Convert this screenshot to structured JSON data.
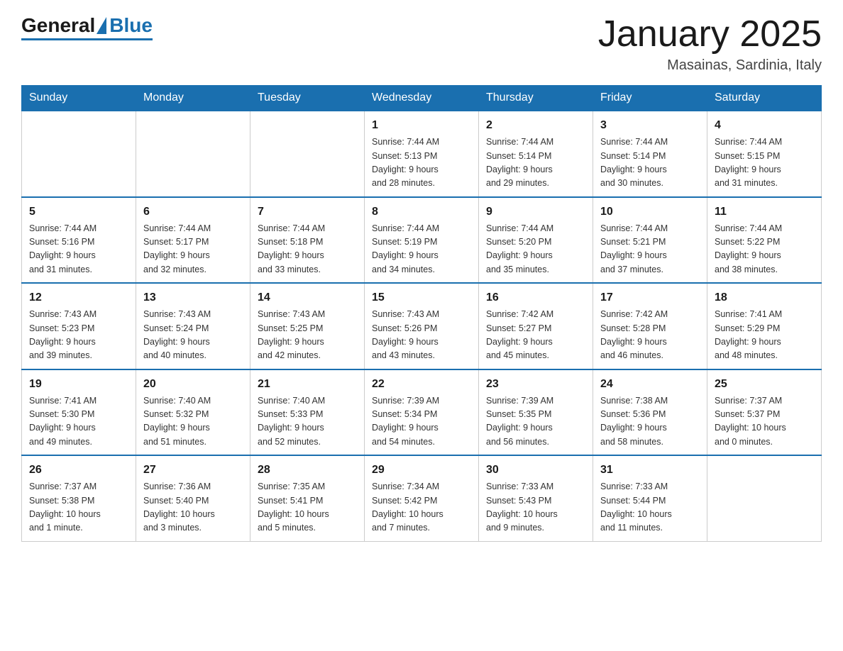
{
  "header": {
    "logo_general": "General",
    "logo_blue": "Blue",
    "month_title": "January 2025",
    "location": "Masainas, Sardinia, Italy"
  },
  "weekdays": [
    "Sunday",
    "Monday",
    "Tuesday",
    "Wednesday",
    "Thursday",
    "Friday",
    "Saturday"
  ],
  "weeks": [
    [
      {
        "day": "",
        "info": ""
      },
      {
        "day": "",
        "info": ""
      },
      {
        "day": "",
        "info": ""
      },
      {
        "day": "1",
        "info": "Sunrise: 7:44 AM\nSunset: 5:13 PM\nDaylight: 9 hours\nand 28 minutes."
      },
      {
        "day": "2",
        "info": "Sunrise: 7:44 AM\nSunset: 5:14 PM\nDaylight: 9 hours\nand 29 minutes."
      },
      {
        "day": "3",
        "info": "Sunrise: 7:44 AM\nSunset: 5:14 PM\nDaylight: 9 hours\nand 30 minutes."
      },
      {
        "day": "4",
        "info": "Sunrise: 7:44 AM\nSunset: 5:15 PM\nDaylight: 9 hours\nand 31 minutes."
      }
    ],
    [
      {
        "day": "5",
        "info": "Sunrise: 7:44 AM\nSunset: 5:16 PM\nDaylight: 9 hours\nand 31 minutes."
      },
      {
        "day": "6",
        "info": "Sunrise: 7:44 AM\nSunset: 5:17 PM\nDaylight: 9 hours\nand 32 minutes."
      },
      {
        "day": "7",
        "info": "Sunrise: 7:44 AM\nSunset: 5:18 PM\nDaylight: 9 hours\nand 33 minutes."
      },
      {
        "day": "8",
        "info": "Sunrise: 7:44 AM\nSunset: 5:19 PM\nDaylight: 9 hours\nand 34 minutes."
      },
      {
        "day": "9",
        "info": "Sunrise: 7:44 AM\nSunset: 5:20 PM\nDaylight: 9 hours\nand 35 minutes."
      },
      {
        "day": "10",
        "info": "Sunrise: 7:44 AM\nSunset: 5:21 PM\nDaylight: 9 hours\nand 37 minutes."
      },
      {
        "day": "11",
        "info": "Sunrise: 7:44 AM\nSunset: 5:22 PM\nDaylight: 9 hours\nand 38 minutes."
      }
    ],
    [
      {
        "day": "12",
        "info": "Sunrise: 7:43 AM\nSunset: 5:23 PM\nDaylight: 9 hours\nand 39 minutes."
      },
      {
        "day": "13",
        "info": "Sunrise: 7:43 AM\nSunset: 5:24 PM\nDaylight: 9 hours\nand 40 minutes."
      },
      {
        "day": "14",
        "info": "Sunrise: 7:43 AM\nSunset: 5:25 PM\nDaylight: 9 hours\nand 42 minutes."
      },
      {
        "day": "15",
        "info": "Sunrise: 7:43 AM\nSunset: 5:26 PM\nDaylight: 9 hours\nand 43 minutes."
      },
      {
        "day": "16",
        "info": "Sunrise: 7:42 AM\nSunset: 5:27 PM\nDaylight: 9 hours\nand 45 minutes."
      },
      {
        "day": "17",
        "info": "Sunrise: 7:42 AM\nSunset: 5:28 PM\nDaylight: 9 hours\nand 46 minutes."
      },
      {
        "day": "18",
        "info": "Sunrise: 7:41 AM\nSunset: 5:29 PM\nDaylight: 9 hours\nand 48 minutes."
      }
    ],
    [
      {
        "day": "19",
        "info": "Sunrise: 7:41 AM\nSunset: 5:30 PM\nDaylight: 9 hours\nand 49 minutes."
      },
      {
        "day": "20",
        "info": "Sunrise: 7:40 AM\nSunset: 5:32 PM\nDaylight: 9 hours\nand 51 minutes."
      },
      {
        "day": "21",
        "info": "Sunrise: 7:40 AM\nSunset: 5:33 PM\nDaylight: 9 hours\nand 52 minutes."
      },
      {
        "day": "22",
        "info": "Sunrise: 7:39 AM\nSunset: 5:34 PM\nDaylight: 9 hours\nand 54 minutes."
      },
      {
        "day": "23",
        "info": "Sunrise: 7:39 AM\nSunset: 5:35 PM\nDaylight: 9 hours\nand 56 minutes."
      },
      {
        "day": "24",
        "info": "Sunrise: 7:38 AM\nSunset: 5:36 PM\nDaylight: 9 hours\nand 58 minutes."
      },
      {
        "day": "25",
        "info": "Sunrise: 7:37 AM\nSunset: 5:37 PM\nDaylight: 10 hours\nand 0 minutes."
      }
    ],
    [
      {
        "day": "26",
        "info": "Sunrise: 7:37 AM\nSunset: 5:38 PM\nDaylight: 10 hours\nand 1 minute."
      },
      {
        "day": "27",
        "info": "Sunrise: 7:36 AM\nSunset: 5:40 PM\nDaylight: 10 hours\nand 3 minutes."
      },
      {
        "day": "28",
        "info": "Sunrise: 7:35 AM\nSunset: 5:41 PM\nDaylight: 10 hours\nand 5 minutes."
      },
      {
        "day": "29",
        "info": "Sunrise: 7:34 AM\nSunset: 5:42 PM\nDaylight: 10 hours\nand 7 minutes."
      },
      {
        "day": "30",
        "info": "Sunrise: 7:33 AM\nSunset: 5:43 PM\nDaylight: 10 hours\nand 9 minutes."
      },
      {
        "day": "31",
        "info": "Sunrise: 7:33 AM\nSunset: 5:44 PM\nDaylight: 10 hours\nand 11 minutes."
      },
      {
        "day": "",
        "info": ""
      }
    ]
  ]
}
